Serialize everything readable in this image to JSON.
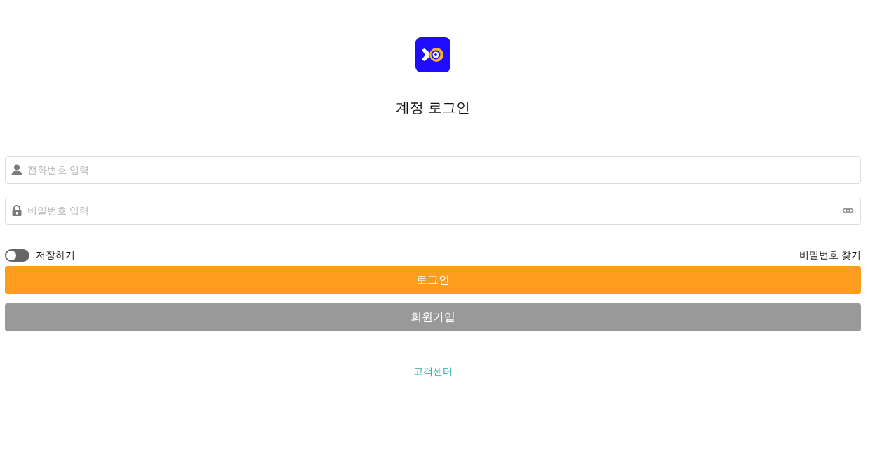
{
  "title": "계정 로그인",
  "phone_field": {
    "placeholder": "전화번호 입력"
  },
  "password_field": {
    "placeholder": "비밀번호 입력"
  },
  "remember": {
    "label": "저장하기",
    "on": false
  },
  "find_password": "비밀번호 찾기",
  "buttons": [
    {
      "label": "로그인",
      "kind": "primary"
    },
    {
      "label": "회원가입",
      "kind": "secondary"
    }
  ],
  "support_link": "고객센터"
}
